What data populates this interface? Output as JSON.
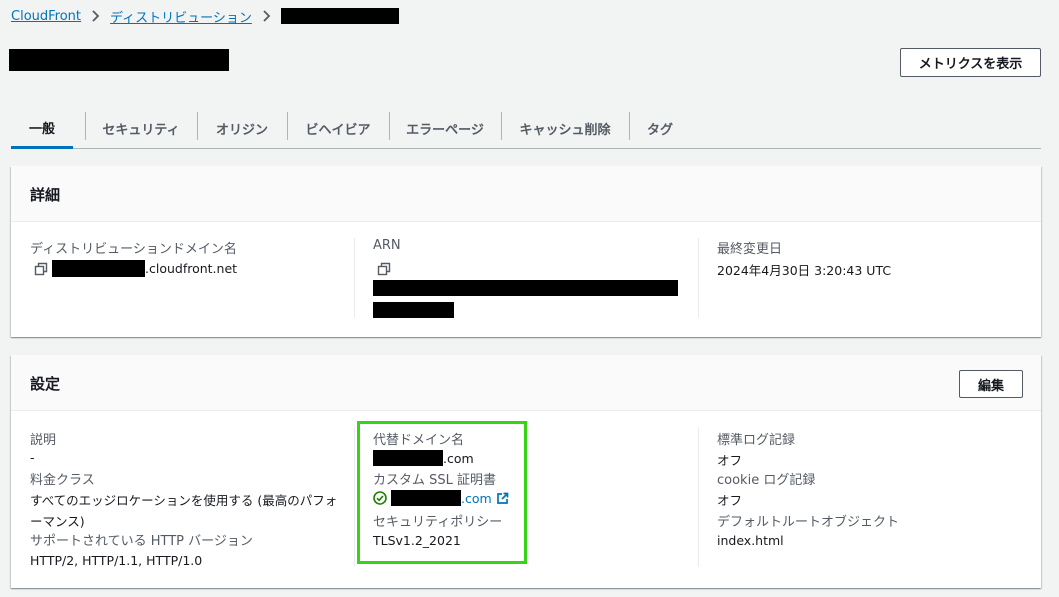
{
  "breadcrumb": {
    "items": [
      "CloudFront",
      "ディストリビューション"
    ]
  },
  "header": {
    "metrics_button": "メトリクスを表示"
  },
  "tabs": [
    {
      "label": "一般",
      "active": true
    },
    {
      "label": "セキュリティ"
    },
    {
      "label": "オリジン"
    },
    {
      "label": "ビヘイビア"
    },
    {
      "label": "エラーページ"
    },
    {
      "label": "キャッシュ削除"
    },
    {
      "label": "タグ"
    }
  ],
  "details": {
    "title": "詳細",
    "domain_label": "ディストリビューションドメイン名",
    "domain_suffix": ".cloudfront.net",
    "arn_label": "ARN",
    "modified_label": "最終変更日",
    "modified_value": "2024年4月30日 3:20:43 UTC"
  },
  "settings": {
    "title": "設定",
    "edit_button": "編集",
    "description_label": "説明",
    "description_value": "-",
    "price_class_label": "料金クラス",
    "price_class_value": "すべてのエッジロケーションを使用する (最高のパフォーマンス)",
    "http_label": "サポートされている HTTP バージョン",
    "http_value": "HTTP/2, HTTP/1.1, HTTP/1.0",
    "alt_domain_label": "代替ドメイン名",
    "alt_domain_suffix": ".com",
    "ssl_label": "カスタム SSL 証明書",
    "ssl_suffix": ".com",
    "security_policy_label": "セキュリティポリシー",
    "security_policy_value": "TLSv1.2_2021",
    "std_log_label": "標準ログ記録",
    "std_log_value": "オフ",
    "cookie_log_label": "cookie ログ記録",
    "cookie_log_value": "オフ",
    "default_root_label": "デフォルトルートオブジェクト",
    "default_root_value": "index.html"
  },
  "colors": {
    "link": "#0073bb",
    "highlight": "#35d415",
    "success": "#1d8102"
  }
}
